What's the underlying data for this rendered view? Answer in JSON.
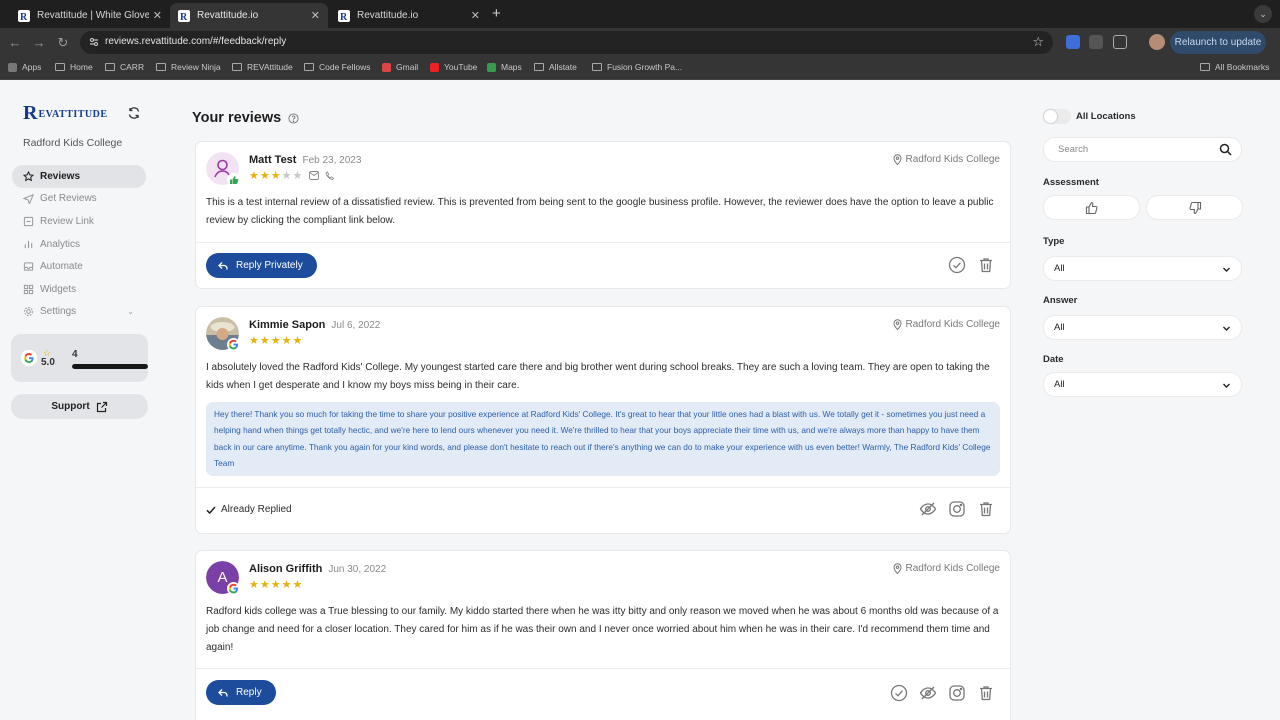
{
  "browser": {
    "tabs": [
      {
        "title": "Revattitude | White Glove Rev",
        "active": false
      },
      {
        "title": "Revattitude.io",
        "active": true
      },
      {
        "title": "Revattitude.io",
        "active": false
      }
    ],
    "new_tab": "+",
    "url": "reviews.revattitude.com/#/feedback/reply",
    "relaunch_label": "Relaunch to update",
    "bookmarks": [
      "Apps",
      "Home",
      "CARR",
      "Review Ninja",
      "REVAttitude",
      "Code Fellows",
      "Gmail",
      "YouTube",
      "Maps",
      "Allstate",
      "Fusion Growth Pa..."
    ],
    "all_bookmarks": "All Bookmarks"
  },
  "sidebar": {
    "logo_mark": "R",
    "logo_text": "EVATTITUDE",
    "location": "Radford Kids College",
    "nav": [
      {
        "label": "Reviews",
        "icon": "star-icon",
        "active": true
      },
      {
        "label": "Get Reviews",
        "icon": "send-icon",
        "active": false
      },
      {
        "label": "Review Link",
        "icon": "link-icon",
        "active": false
      },
      {
        "label": "Analytics",
        "icon": "bar-chart-icon",
        "active": false
      },
      {
        "label": "Automate",
        "icon": "inbox-icon",
        "active": false
      },
      {
        "label": "Widgets",
        "icon": "grid-icon",
        "active": false
      },
      {
        "label": "Settings",
        "icon": "gear-icon",
        "active": false
      }
    ],
    "rating": {
      "score": "5.0",
      "count": "4",
      "fill_fraction": 1.0
    },
    "support_label": "Support"
  },
  "main": {
    "title": "Your reviews",
    "reviews": [
      {
        "name": "Matt Test",
        "date": "Feb 23, 2023",
        "stars": 3,
        "location": "Radford Kids College",
        "text": "This is a test internal review of a dissatisfied review. This is prevented from being sent to the google business profile. However, the reviewer does have the option to leave a public review by clicking the compliant link below.",
        "action_label": "Reply Privately"
      },
      {
        "name": "Kimmie Sapon",
        "date": "Jul 6, 2022",
        "stars": 5,
        "location": "Radford Kids College",
        "text": "I absolutely loved the Radford Kids' College. My youngest started care there and big brother went during school breaks. They are such a loving team. They are open to taking the kids when I get desperate and I know my boys miss being in their care.",
        "reply": "Hey there! Thank you so much for taking the time to share your positive experience at Radford Kids' College. It's great to hear that your little ones had a blast with us. We totally get it - sometimes you just need a helping hand when things get totally hectic, and we're here to lend ours whenever you need it. We're thrilled to hear that your boys appreciate their time with us, and we're always more than happy to have them back in our care anytime. Thank you again for your kind words, and please don't hesitate to reach out if there's anything we can do to make your experience with us even better! Warmly, The Radford Kids' College Team",
        "status_label": "Already Replied"
      },
      {
        "name": "Alison Griffith",
        "initial": "A",
        "date": "Jun 30, 2022",
        "stars": 5,
        "location": "Radford Kids College",
        "text": "Radford kids college was a True blessing to our family. My kiddo started there when he was itty bitty and only reason we moved when he was about 6 months old was because of a job change and need for a closer location. They cared for him as if he was their own and I never once worried about him when he was in their care. I'd recommend them time and again!",
        "action_label": "Reply"
      }
    ]
  },
  "filters": {
    "all_locations_label": "All Locations",
    "search_placeholder": "Search",
    "assessment_label": "Assessment",
    "type_label": "Type",
    "type_value": "All",
    "answer_label": "Answer",
    "answer_value": "All",
    "date_label": "Date",
    "date_value": "All"
  },
  "colors": {
    "primary": "#1d4c9c",
    "star": "#e8b10a",
    "reply_bg": "#e3ebf6",
    "reply_text": "#2c5fa8"
  }
}
